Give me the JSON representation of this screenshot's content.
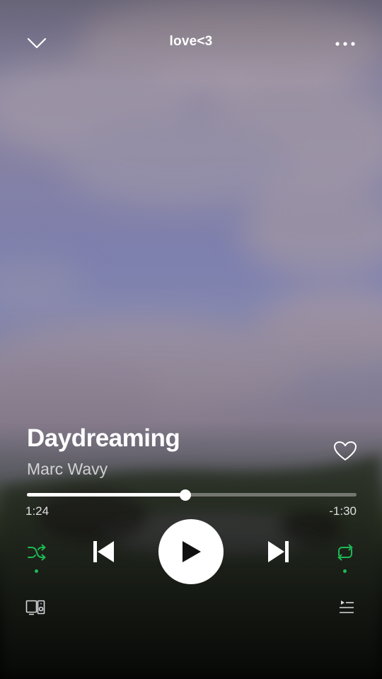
{
  "header": {
    "context_title": "love<3",
    "collapse_icon": "chevron-down-icon",
    "more_icon": "more-horizontal-icon"
  },
  "track": {
    "title": "Daydreaming",
    "artist": "Marc Wavy",
    "liked": false,
    "like_icon": "heart-outline-icon"
  },
  "playback": {
    "elapsed": "1:24",
    "remaining": "-1:30",
    "progress_fraction": 0.48,
    "is_playing": false
  },
  "controls": {
    "shuffle_icon": "shuffle-icon",
    "shuffle_active": true,
    "previous_icon": "skip-previous-icon",
    "play_icon": "play-icon",
    "next_icon": "skip-next-icon",
    "repeat_icon": "repeat-icon",
    "repeat_active": true
  },
  "footer": {
    "devices_icon": "connect-devices-icon",
    "queue_icon": "queue-icon"
  },
  "colors": {
    "accent": "#1db954",
    "text_primary": "#ffffff",
    "text_secondary": "#c8c8cc",
    "play_button_bg": "#ffffff",
    "play_glyph": "#111111"
  }
}
